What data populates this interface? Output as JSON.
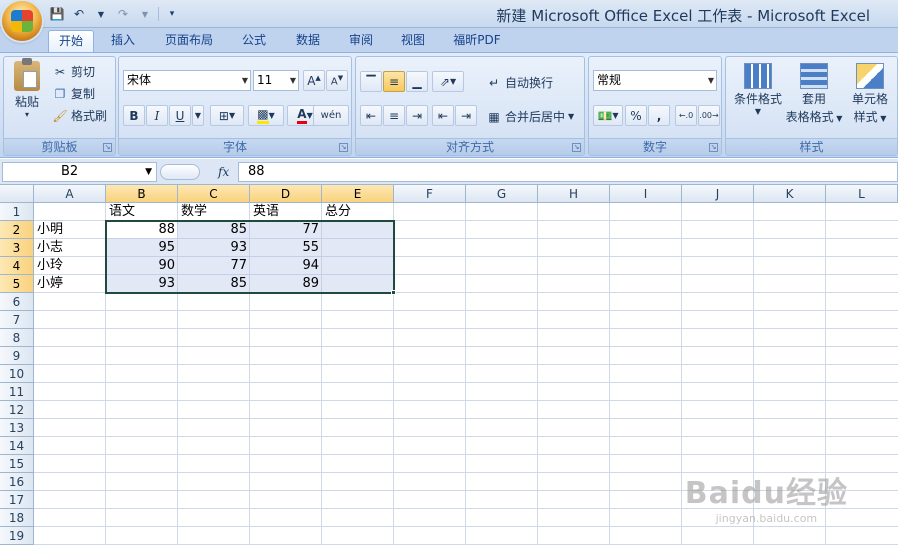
{
  "window": {
    "title": "新建 Microsoft Office Excel 工作表 - Microsoft Excel"
  },
  "tabs": [
    "开始",
    "插入",
    "页面布局",
    "公式",
    "数据",
    "审阅",
    "视图",
    "福昕PDF"
  ],
  "clipboard": {
    "group_label": "剪贴板",
    "paste": "粘贴",
    "cut": "剪切",
    "copy": "复制",
    "format_painter": "格式刷"
  },
  "font": {
    "group_label": "字体",
    "name": "宋体",
    "size": "11",
    "bold": "B",
    "italic": "I",
    "underline": "U",
    "font_color_letter": "A",
    "phonetic": "wén"
  },
  "alignment": {
    "group_label": "对齐方式",
    "wrap_text": "自动换行",
    "merge_center": "合并后居中"
  },
  "number": {
    "group_label": "数字",
    "format": "常规",
    "percent": "%",
    "comma": ","
  },
  "styles": {
    "group_label": "样式",
    "conditional_format": "条件格式",
    "table_format_line1": "套用",
    "table_format_line2": "表格格式",
    "cell_styles_line1": "单元格",
    "cell_styles_line2": "样式"
  },
  "formula_bar": {
    "name_box": "B2",
    "fx": "fx",
    "value": "88"
  },
  "columns": [
    "A",
    "B",
    "C",
    "D",
    "E",
    "F",
    "G",
    "H",
    "I",
    "J",
    "K",
    "L"
  ],
  "rows": [
    "1",
    "2",
    "3",
    "4",
    "5",
    "6",
    "7",
    "8",
    "9",
    "10",
    "11",
    "12",
    "13",
    "14",
    "15",
    "16",
    "17",
    "18",
    "19"
  ],
  "sheet": {
    "headers": [
      "语文",
      "数学",
      "英语",
      "总分"
    ],
    "students": [
      {
        "name": "小明",
        "scores": [
          "88",
          "85",
          "77"
        ]
      },
      {
        "name": "小志",
        "scores": [
          "95",
          "93",
          "55"
        ]
      },
      {
        "name": "小玲",
        "scores": [
          "90",
          "77",
          "94"
        ]
      },
      {
        "name": "小婷",
        "scores": [
          "93",
          "85",
          "89"
        ]
      }
    ]
  },
  "watermark": {
    "big": "Baidu经验",
    "small": "jingyan.baidu.com"
  }
}
